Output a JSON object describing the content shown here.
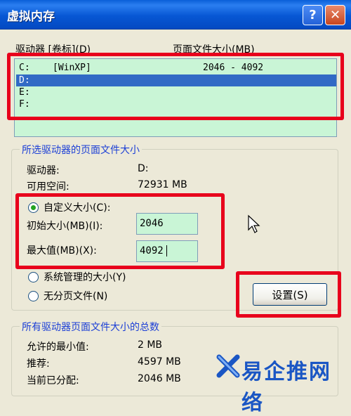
{
  "window": {
    "title": "虚拟内存",
    "help_label": "?",
    "close_label": "✕"
  },
  "drive_list": {
    "header_drive": "驱动器 [卷标](D)",
    "header_size": "页面文件大小(MB)",
    "rows": [
      {
        "drive": "C:",
        "label": "[WinXP]",
        "size": "2046 - 4092",
        "selected": false
      },
      {
        "drive": "D:",
        "label": "",
        "size": "",
        "selected": true
      },
      {
        "drive": "E:",
        "label": "",
        "size": "",
        "selected": false
      },
      {
        "drive": "F:",
        "label": "",
        "size": "",
        "selected": false
      }
    ]
  },
  "selected_drive": {
    "group_title": "所选驱动器的页面文件大小",
    "drive_label": "驱动器:",
    "drive_value": "D:",
    "free_label": "可用空间:",
    "free_value": "72931 MB",
    "custom_size_label": "自定义大小(C):",
    "initial_label": "初始大小(MB)(I):",
    "initial_value": "2046",
    "max_label": "最大值(MB)(X):",
    "max_value": "4092",
    "system_managed_label": "系统管理的大小(Y)",
    "no_paging_label": "无分页文件(N)",
    "set_button": "设置(S)",
    "selected_option": "custom"
  },
  "totals": {
    "group_title": "所有驱动器页面文件大小的总数",
    "min_label": "允许的最小值:",
    "min_value": "2 MB",
    "recommended_label": "推荐:",
    "recommended_value": "4597 MB",
    "current_label": "当前已分配:",
    "current_value": "2046 MB"
  },
  "watermark": {
    "text": "易企推网络"
  },
  "colors": {
    "title_bar": "#0757d4",
    "list_bg": "#c9f5d6",
    "selection": "#316ac5",
    "highlight_box": "#e8001c",
    "group_title": "#1c3fd6"
  }
}
